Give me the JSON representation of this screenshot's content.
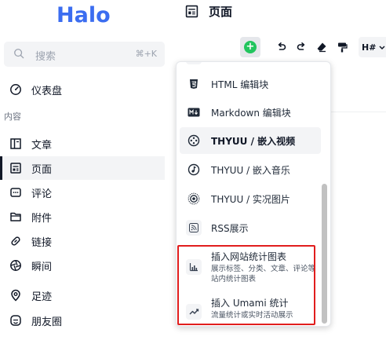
{
  "sidebar": {
    "logo": "Halo",
    "search": {
      "placeholder": "搜索",
      "shortcut": "⌘+K"
    },
    "section_label": "内容",
    "items": [
      {
        "label": "仪表盘",
        "icon": "dashboard-icon"
      },
      {
        "label": "文章",
        "icon": "article-icon"
      },
      {
        "label": "页面",
        "icon": "page-icon",
        "active": true
      },
      {
        "label": "评论",
        "icon": "comment-icon"
      },
      {
        "label": "附件",
        "icon": "folder-icon"
      },
      {
        "label": "链接",
        "icon": "link-icon"
      },
      {
        "label": "瞬间",
        "icon": "moment-icon"
      },
      {
        "label": "足迹",
        "icon": "location-icon"
      },
      {
        "label": "朋友圈",
        "icon": "friends-icon"
      }
    ]
  },
  "header": {
    "title": "页面",
    "icon": "page-icon"
  },
  "toolbar": {
    "buttons": [
      {
        "name": "insert",
        "icon": "plus-circle-icon"
      },
      {
        "name": "undo",
        "icon": "undo-icon"
      },
      {
        "name": "redo",
        "icon": "redo-icon"
      },
      {
        "name": "eraser",
        "icon": "eraser-icon"
      },
      {
        "name": "format-painter",
        "icon": "format-painter-icon"
      }
    ],
    "heading_label": "H#"
  },
  "dropdown": {
    "items": [
      {
        "label": "HTML 编辑块",
        "icon": "html5-icon"
      },
      {
        "label": "Markdown 编辑块",
        "icon": "markdown-icon"
      },
      {
        "label": "THYUU / 嵌入视频",
        "icon": "video-icon",
        "highlighted": true
      },
      {
        "label": "THYUU / 嵌入音乐",
        "icon": "music-icon"
      },
      {
        "label": "THYUU / 实况图片",
        "icon": "live-photo-icon"
      },
      {
        "label": "RSS展示",
        "icon": "rss-icon"
      },
      {
        "label": "插入网站统计图表",
        "desc": "展示标签、分类、文章、评论等站内统计图表",
        "icon": "bar-chart-icon"
      },
      {
        "label": "插入 Umami 统计",
        "desc": "流量统计或实时活动展示",
        "icon": "trend-icon"
      }
    ]
  },
  "colors": {
    "brand": "#3b6df0",
    "accent_green": "#22c55e",
    "highlight_box": "#e11d1d"
  }
}
